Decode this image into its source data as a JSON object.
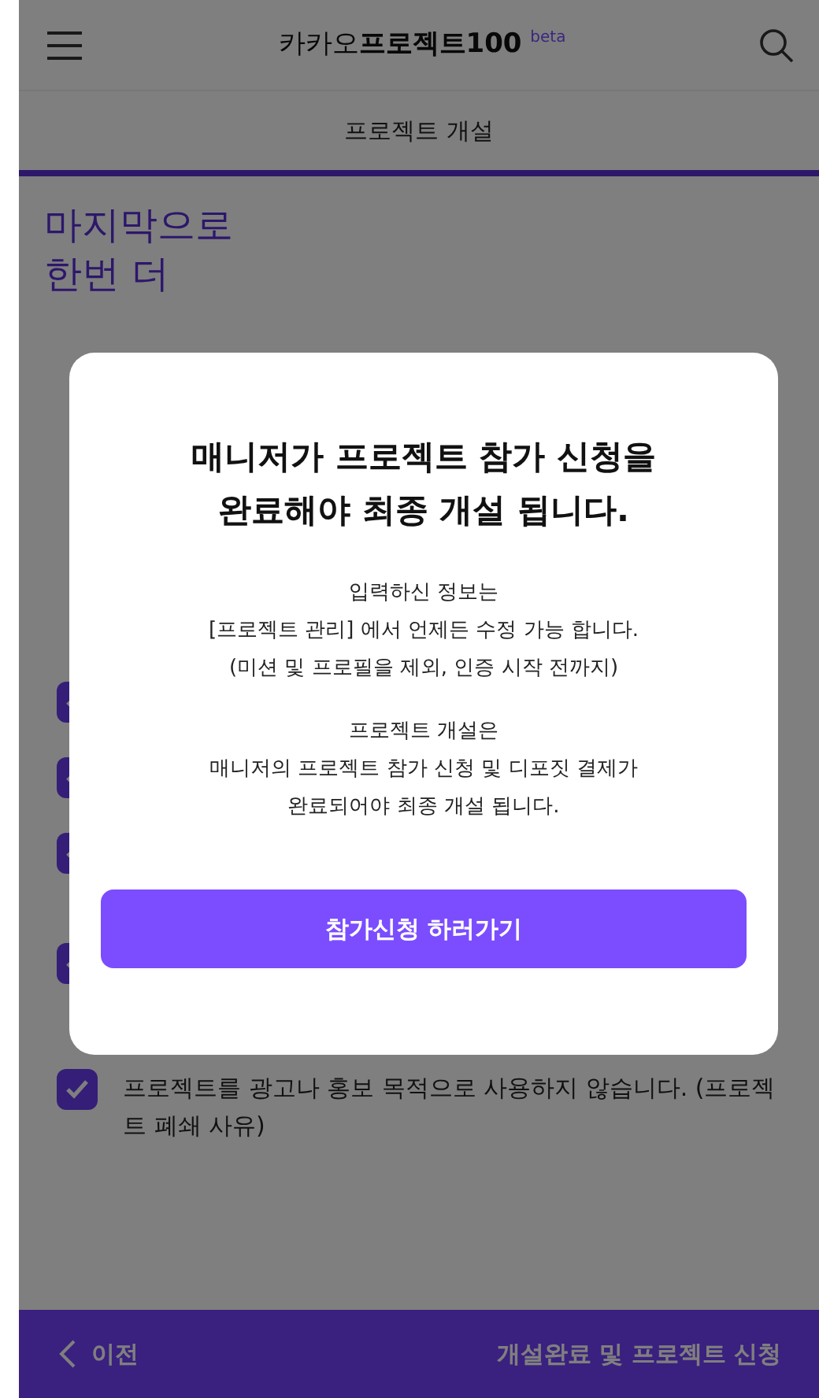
{
  "header": {
    "brand_light": "카카오",
    "brand_bold": "프로젝트100",
    "badge": "beta"
  },
  "subheader": {
    "title": "프로젝트 개설"
  },
  "heading_lines": [
    "마지막으로",
    "한번 더"
  ],
  "agreements": [
    {
      "checked": true
    },
    {
      "checked": true
    },
    {
      "checked": true
    },
    {
      "checked": true
    },
    {
      "checked": true,
      "text": "프로젝트를 광고나 홍보 목적으로 사용하지 않습니다. (프로젝트 폐쇄 사유)"
    }
  ],
  "modal": {
    "title_lines": [
      "매니저가 프로젝트 참가 신청을",
      "완료해야 최종 개설 됩니다."
    ],
    "paragraphs": [
      [
        "입력하신 정보는",
        "[프로젝트 관리] 에서 언제든 수정 가능 합니다.",
        "(미션 및 프로필을 제외, 인증 시작 전까지)"
      ],
      [
        "프로젝트 개설은",
        "매니저의 프로젝트 참가 신청 및 디포짓 결제가",
        "완료되어야 최종 개설 됩니다."
      ]
    ],
    "button": "참가신청 하러가기"
  },
  "footer": {
    "back": "이전",
    "next": "개설완료 및 프로젝트 신청"
  }
}
